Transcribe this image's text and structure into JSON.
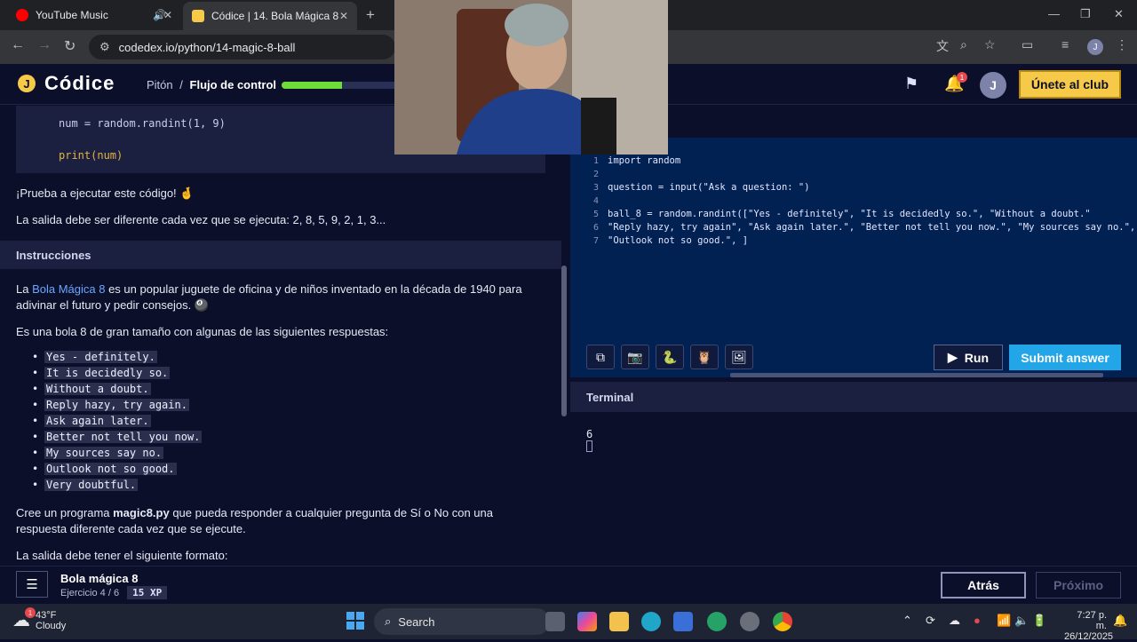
{
  "browser": {
    "tabs": [
      {
        "title": "YouTube Music",
        "favicon_color": "#ff0000"
      },
      {
        "title": "Códice | 14. Bola Mágica 8",
        "favicon_color": "#f7c948"
      }
    ],
    "url": "codedex.io/python/14-magic-8-ball",
    "new_tab_label": "+"
  },
  "header": {
    "logo_text": "Códice",
    "logo_letter": "J",
    "breadcrumb_course": "Pitón",
    "breadcrumb_sep": "/",
    "breadcrumb_section": "Flujo de control",
    "progress": 0.52,
    "notification_count": "1",
    "avatar_letter": "J",
    "join_label": "Únete al club"
  },
  "lesson": {
    "code_lines": [
      "num = random.randint(1, 9)",
      "print(num)"
    ],
    "try_text": "¡Prueba a ejecutar este código! 🤞",
    "output_text": "La salida debe ser diferente cada vez que se ejecuta: 2, 8, 5, 9, 2, 1, 3...",
    "instructions_header": "Instrucciones",
    "intro_prefix": "La ",
    "intro_link": "Bola Mágica 8",
    "intro_suffix": " es un popular juguete de oficina y de niños inventado en la década de 1940 para adivinar el futuro y pedir consejos. 🎱",
    "answers_intro": "Es una bola 8 de gran tamaño con algunas de las siguientes respuestas:",
    "answers": [
      "Yes - definitely.",
      "It is decidedly so.",
      "Without a doubt.",
      "Reply hazy, try again.",
      "Ask again later.",
      "Better not tell you now.",
      "My sources say no.",
      "Outlook not so good.",
      "Very doubtful."
    ],
    "program_prefix": "Cree un programa ",
    "program_file": "magic8.py",
    "program_suffix": " que pueda responder a cualquier pregunta de Sí o No con una respuesta diferente cada vez que se ejecute.",
    "format_text": "La salida debe tener el siguiente formato:"
  },
  "editor": {
    "lines": [
      {
        "n": "1",
        "text": "import random"
      },
      {
        "n": "2",
        "text": ""
      },
      {
        "n": "3",
        "text": "question = input(\"Ask a question: \")"
      },
      {
        "n": "4",
        "text": ""
      },
      {
        "n": "5",
        "text": "ball_8 = random.randint([\"Yes - definitely\", \"It is decidedly so.\", \"Without a doubt.\""
      },
      {
        "n": "6",
        "text": "\"Reply hazy, try again\", \"Ask again later.\", \"Better not tell you now.\", \"My sources say no.\","
      },
      {
        "n": "7",
        "text": "\"Outlook not so good.\", ]"
      }
    ],
    "run_label": "Run",
    "submit_label": "Submit answer"
  },
  "terminal": {
    "title": "Terminal",
    "output": "6"
  },
  "footer": {
    "exercise_title": "Bola mágica 8",
    "exercise_label": "Ejercicio",
    "exercise_num": "4",
    "exercise_sep": "/",
    "exercise_total": "6",
    "xp": "15 XP",
    "back_label": "Atrás",
    "next_label": "Próximo"
  },
  "taskbar": {
    "weather_temp": "43°F",
    "weather_desc": "Cloudy",
    "weather_badge": "1",
    "search_label": "Search",
    "time": "7:27 p. m.",
    "date": "26/12/2025"
  },
  "colors": {
    "accent_yellow": "#f7c948",
    "progress_green": "#6fdc3c",
    "submit_blue": "#22a6e8",
    "editor_bg": "#002152",
    "page_bg": "#0b0f2a"
  }
}
